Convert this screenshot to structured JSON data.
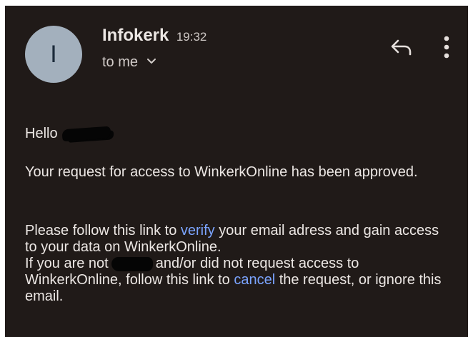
{
  "email": {
    "sender": {
      "avatar_letter": "I",
      "name": "Infokerk",
      "time": "19:32"
    },
    "recipient_label": "to me",
    "icons": {
      "reply": "reply-icon",
      "more": "more-vert-icon",
      "expand": "chevron-down-icon"
    },
    "body": {
      "greeting": "Hello",
      "paragraph1": "Your request for access to WinkerkOnline has been approved.",
      "p2_text_before_verify": "Please follow this link to ",
      "p2_verify_link": "verify",
      "p2_text_after_verify": " your email adress and gain access to your data on WinkerkOnline.",
      "p2_line2_before_redaction": "If you are not",
      "p2_line2_after_redaction": "and/or did not request access to WinkerkOnline, follow this link to ",
      "p2_cancel_link": "cancel",
      "p2_text_after_cancel": " the request, or ignore this email."
    }
  },
  "colors": {
    "background": "#201a18",
    "avatar_bg": "#a3b0bd",
    "text": "#ece7e4",
    "link": "#7ba4ff"
  }
}
